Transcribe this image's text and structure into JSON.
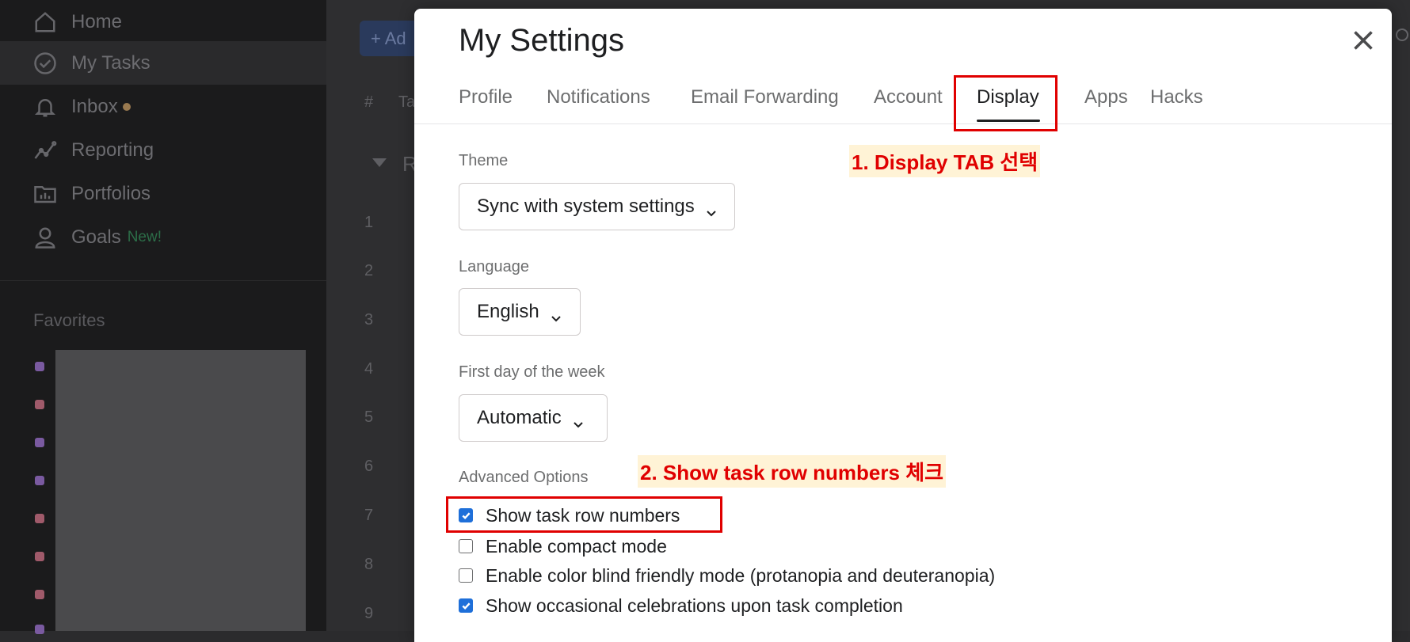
{
  "sidebar": {
    "items": [
      {
        "label": "Home",
        "icon": "home-icon"
      },
      {
        "label": "My Tasks",
        "icon": "check-circle-icon",
        "active": true
      },
      {
        "label": "Inbox",
        "icon": "bell-icon",
        "badge_dot": true
      },
      {
        "label": "Reporting",
        "icon": "chart-line-icon"
      },
      {
        "label": "Portfolios",
        "icon": "folder-chart-icon"
      },
      {
        "label": "Goals",
        "icon": "person-icon",
        "badge": "New!"
      }
    ],
    "favorites_heading": "Favorites",
    "favorite_dot_colors": [
      "#7a5aa0",
      "#a05a6a",
      "#7a5aa0",
      "#7a5aa0",
      "#a05a6a",
      "#a05a6a",
      "#a05a6a",
      "#7a5aa0"
    ]
  },
  "main": {
    "add_button": "+ Ad",
    "col_hash": "#",
    "col_task": "Ta",
    "section_letter": "R",
    "row_numbers": [
      "1",
      "2",
      "3",
      "4",
      "5",
      "6",
      "7",
      "8",
      "9"
    ]
  },
  "modal": {
    "title": "My Settings",
    "tabs": [
      {
        "label": "Profile"
      },
      {
        "label": "Notifications"
      },
      {
        "label": "Email Forwarding"
      },
      {
        "label": "Account"
      },
      {
        "label": "Display",
        "active": true
      },
      {
        "label": "Apps"
      },
      {
        "label": "Hacks"
      }
    ],
    "theme": {
      "label": "Theme",
      "value": "Sync with system settings"
    },
    "language": {
      "label": "Language",
      "value": "English"
    },
    "first_day": {
      "label": "First day of the week",
      "value": "Automatic"
    },
    "advanced": {
      "label": "Advanced Options",
      "options": [
        {
          "label": "Show task row numbers",
          "checked": true
        },
        {
          "label": "Enable compact mode",
          "checked": false
        },
        {
          "label": "Enable color blind friendly mode (protanopia and deuteranopia)",
          "checked": false
        },
        {
          "label": "Show occasional celebrations upon task completion",
          "checked": true
        }
      ]
    }
  },
  "annotations": {
    "step1": "1. Display TAB 선택",
    "step2": "2. Show task row numbers 체크"
  },
  "colors": {
    "accent_checkbox": "#1e6fd9",
    "annotation_red": "#e00000",
    "annotation_bg": "#fff3d6"
  }
}
